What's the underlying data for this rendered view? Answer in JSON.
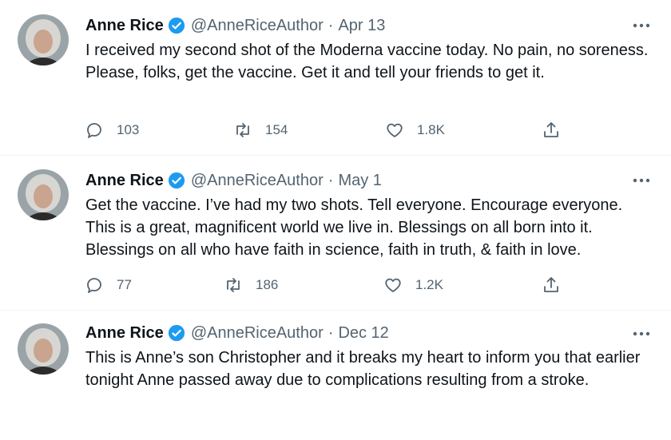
{
  "tweets": [
    {
      "name": "Anne Rice",
      "handle": "@AnneRiceAuthor",
      "separator": "·",
      "date": "Apr 13",
      "text": "I received my second shot of the Moderna vaccine today. No pain, no soreness.  Please, folks, get the vaccine. Get it and tell your friends to get it.",
      "replies": "103",
      "retweets": "154",
      "likes": "1.8K"
    },
    {
      "name": "Anne Rice",
      "handle": "@AnneRiceAuthor",
      "separator": "·",
      "date": "May 1",
      "text": "Get the vaccine. I’ve had my two shots. Tell everyone. Encourage everyone. This is a great, magnificent world we live in. Blessings on all born into it. Blessings on all who have faith in science, faith in truth, & faith in love.",
      "replies": "77",
      "retweets": "186",
      "likes": "1.2K"
    },
    {
      "name": "Anne Rice",
      "handle": "@AnneRiceAuthor",
      "separator": "·",
      "date": "Dec 12",
      "text": "This is Anne’s son Christopher and it breaks my heart to inform you that earlier tonight Anne passed away due to complications resulting from a stroke."
    }
  ],
  "icons": {
    "verified": "verified-badge-icon",
    "more": "more-options-icon",
    "reply": "reply-icon",
    "retweet": "retweet-icon",
    "like": "like-icon",
    "share": "share-icon"
  },
  "colors": {
    "text": "#0f1419",
    "secondary": "#536471",
    "verified": "#1d9bf0",
    "divider": "#eff3f4"
  }
}
